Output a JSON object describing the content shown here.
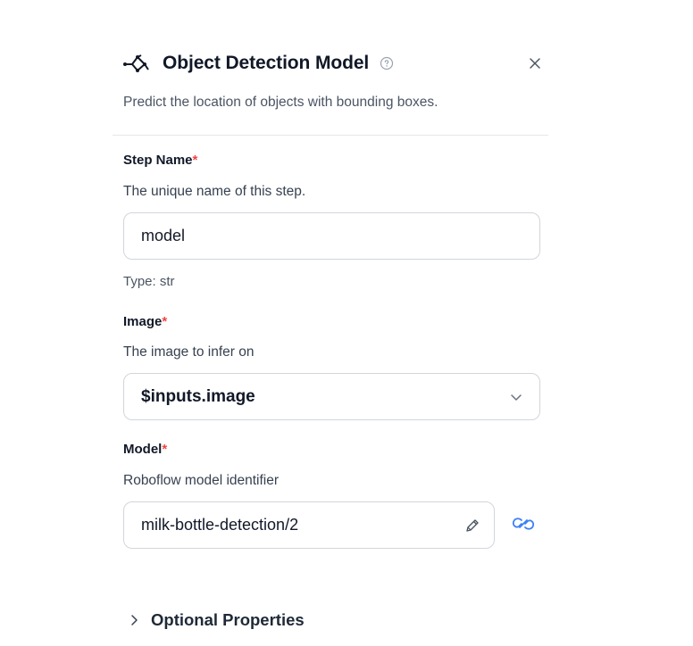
{
  "header": {
    "title": "Object Detection Model",
    "icon": "model-graph-icon",
    "help_icon": "help-circle-icon",
    "close_icon": "close-icon"
  },
  "subtitle": "Predict the location of objects with bounding boxes.",
  "fields": {
    "step_name": {
      "label": "Step Name",
      "required_marker": "*",
      "description": "The unique name of this step.",
      "value": "model",
      "type_hint": "Type: str"
    },
    "image": {
      "label": "Image",
      "required_marker": "*",
      "description": "The image to infer on",
      "selected_value": "$inputs.image"
    },
    "model": {
      "label": "Model",
      "required_marker": "*",
      "description": "Roboflow model identifier",
      "value": "milk-bottle-detection/2",
      "edit_icon": "pencil-icon",
      "link_icon": "link-icon"
    }
  },
  "optional_section": {
    "label": "Optional Properties",
    "expanded": false
  },
  "colors": {
    "required": "#ef4444",
    "link": "#3b82f6",
    "border": "#d1d5db"
  }
}
